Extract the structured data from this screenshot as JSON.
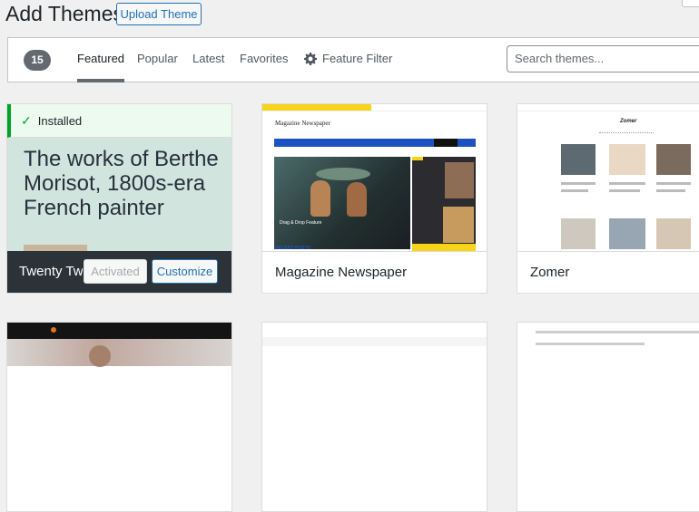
{
  "header": {
    "title": "Add Themes",
    "upload_label": "Upload Theme"
  },
  "filter": {
    "count": "15",
    "tabs": [
      "Featured",
      "Popular",
      "Latest",
      "Favorites",
      "Feature Filter"
    ],
    "search_placeholder": "Search themes..."
  },
  "cards": [
    {
      "name": "Twenty Twenty-One",
      "display_name": "Twenty Twe",
      "installed_label": "Installed",
      "preview_text": "The works of Berthe Morisot, 1800s-era French painter",
      "activated_label": "Activated",
      "customize_label": "Customize"
    },
    {
      "name": "Magazine Newspaper",
      "preview": {
        "site_title": "Magazine Newspaper",
        "hero_caption": "Drag & Drop Feature",
        "recent_label": "RECENT POSTS"
      }
    },
    {
      "name": "Zomer",
      "preview": {
        "site_title": "Zomer"
      }
    }
  ],
  "colors": {
    "accent": "#2271b1",
    "success": "#00a32a",
    "mag_blue": "#1c53c0",
    "mag_yellow": "#f7d417"
  }
}
